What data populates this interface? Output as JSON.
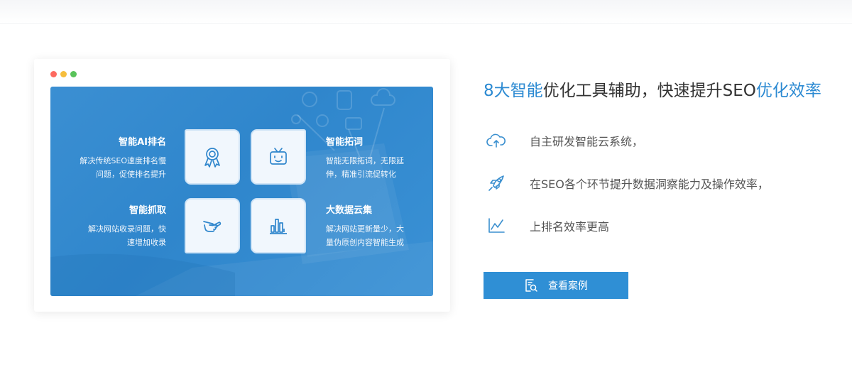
{
  "window": {
    "features": [
      {
        "title": "智能AI排名",
        "desc": [
          "解决传统SEO速度排名慢",
          "问题，促使排名提升"
        ],
        "icon": "award-ribbon-icon"
      },
      {
        "title": "智能拓词",
        "desc": [
          "智能无限拓词，无限延",
          "伸，精准引流促转化"
        ],
        "icon": "tv-bot-icon"
      },
      {
        "title": "智能抓取",
        "desc": [
          "解决网站收录问题，快",
          "速增加收录"
        ],
        "icon": "hand-pointer-icon"
      },
      {
        "title": "大数据云集",
        "desc": [
          "解决网站更新量少，大",
          "量伪原创内容智能生成"
        ],
        "icon": "bar-chart-icon"
      }
    ]
  },
  "headline": {
    "part1": "8大智能",
    "part2": "优化工具辅助，快速提升SEO",
    "part3": "优化效率"
  },
  "points": [
    {
      "text": "自主研发智能云系统，",
      "icon": "cloud-upload-icon"
    },
    {
      "text": "在SEO各个环节提升数据洞察能力及操作效率，",
      "icon": "rocket-icon"
    },
    {
      "text": "上排名效率更高",
      "icon": "line-chart-icon"
    }
  ],
  "cta": {
    "label": "查看案例",
    "icon": "document-search-icon"
  },
  "colors": {
    "accent": "#2c8ad2",
    "panel": "#2f86cc",
    "button": "#2f8fd5",
    "text": "#333333"
  }
}
